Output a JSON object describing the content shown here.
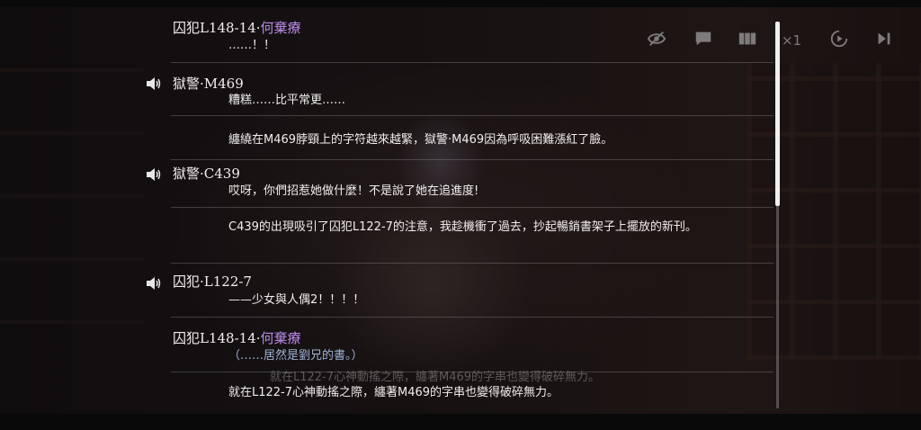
{
  "toolbar": {
    "icons": [
      "eye-hidden-icon",
      "chat-bubble-icon",
      "gallery-icon",
      "speed-icon",
      "auto-play-icon",
      "skip-icon"
    ],
    "speed_label": "×1"
  },
  "log": {
    "entries": [
      {
        "speaker_prefix": "囚犯L148-14·",
        "speaker_name": "何棄療",
        "text": "……！！",
        "voice": false
      },
      {
        "speaker_prefix": "獄警·M469",
        "speaker_name": "",
        "text": "糟糕……比平常更……",
        "voice": true
      },
      {
        "speaker_prefix": "",
        "speaker_name": "",
        "text": "纏繞在M469脖頸上的字符越來越緊，獄警·M469因為呼吸困難漲紅了臉。",
        "voice": false
      },
      {
        "speaker_prefix": "獄警·C439",
        "speaker_name": "",
        "text": "哎呀，你們招惹她做什麼！不是說了她在追進度!",
        "voice": true
      },
      {
        "speaker_prefix": "",
        "speaker_name": "",
        "text": "C439的出現吸引了囚犯L122-7的注意，我趁機衝了過去，抄起暢銷書架子上擺放的新刊。",
        "voice": false
      },
      {
        "speaker_prefix": "囚犯·L122-7",
        "speaker_name": "",
        "text": "——少女與人偶2！！！！",
        "voice": true
      },
      {
        "speaker_prefix": "囚犯L148-14·",
        "speaker_name": "何棄療",
        "text": "（……居然是劉兄的書。）",
        "voice": false
      },
      {
        "speaker_prefix": "",
        "speaker_name": "",
        "text": "就在L122-7心神動搖之際，纏著M469的字串也變得破碎無力。",
        "voice": false
      }
    ]
  },
  "overlay_subtitle": "就在L122-7心神動搖之際，纏著M469的字串也變得破碎無力。",
  "colors": {
    "highlight_name": "#b98ae8",
    "thought_text": "#9fb3d6",
    "text": "#f1eeee"
  }
}
